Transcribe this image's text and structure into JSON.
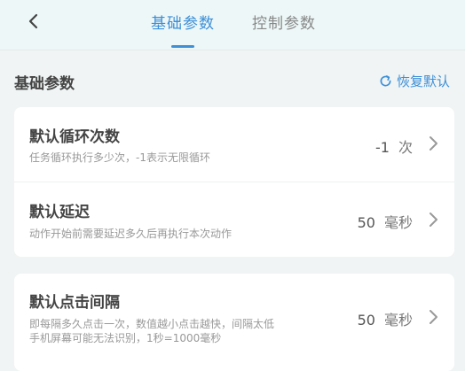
{
  "header": {
    "tabs": [
      {
        "label": "基础参数"
      },
      {
        "label": "控制参数"
      }
    ]
  },
  "section": {
    "title": "基础参数",
    "reset_label": "恢复默认"
  },
  "settings": [
    {
      "title": "默认循环次数",
      "desc": "任务循环执行多少次，-1表示无限循环",
      "value": "-1",
      "unit": "次"
    },
    {
      "title": "默认延迟",
      "desc": "动作开始前需要延迟多久后再执行本次动作",
      "value": "50",
      "unit": "毫秒"
    },
    {
      "title": "默认点击间隔",
      "desc_line1": "即每隔多久点击一次，数值越小点击越快，间隔太低",
      "desc_line2": "手机屏幕可能无法识别，1秒=1000毫秒",
      "value": "50",
      "unit": "毫秒"
    }
  ],
  "colors": {
    "accent": "#3d8fd8",
    "background": "#f0f4f4",
    "card": "#ffffff"
  },
  "icons": [
    "back-arrow-icon",
    "refresh-icon",
    "chevron-right-icon"
  ]
}
